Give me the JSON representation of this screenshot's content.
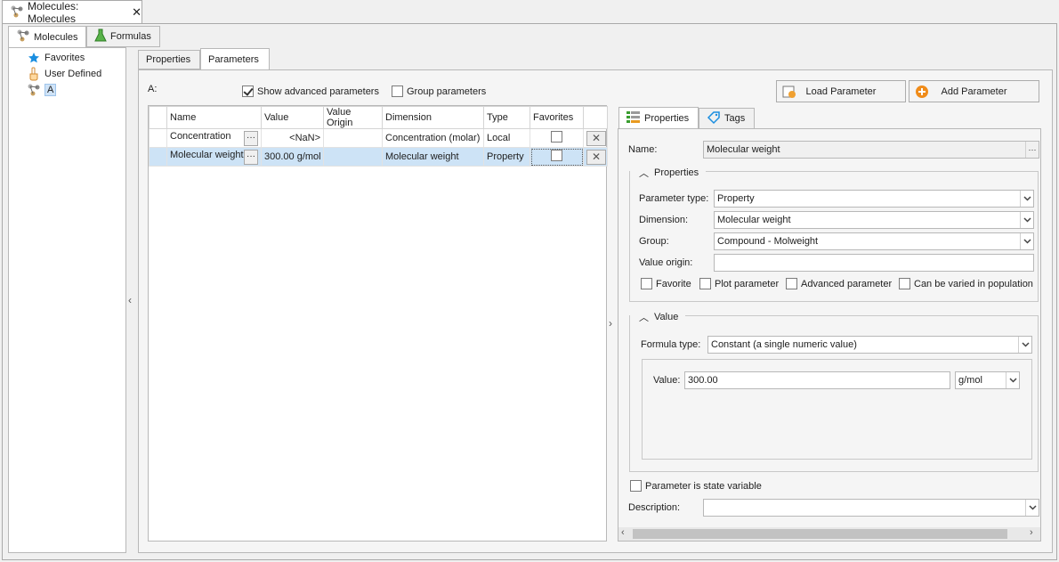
{
  "doc_tab": {
    "title": "Molecules: Molecules",
    "close": "✕"
  },
  "top_tabs": [
    {
      "label": "Molecules"
    },
    {
      "label": "Formulas"
    }
  ],
  "tree": {
    "items": [
      {
        "label": "Favorites"
      },
      {
        "label": "User Defined"
      },
      {
        "label": "A"
      }
    ]
  },
  "sub_tabs": [
    {
      "label": "Properties"
    },
    {
      "label": "Parameters"
    }
  ],
  "params": {
    "container_label": "A:",
    "show_advanced_label": "Show advanced parameters",
    "group_params_label": "Group parameters",
    "load_button": "Load Parameter",
    "add_button": "Add Parameter",
    "columns": [
      "Name",
      "Value",
      "Value Origin",
      "Dimension",
      "Type",
      "Favorites"
    ],
    "rows": [
      {
        "name": "Concentration",
        "value": "<NaN>",
        "origin": "",
        "dimension": "Concentration (molar)",
        "type": "Local"
      },
      {
        "name": "Molecular weight",
        "value": "300.00 g/mol",
        "origin": "",
        "dimension": "Molecular weight",
        "type": "Property"
      }
    ],
    "ellipsis": "···"
  },
  "detail": {
    "tabs": [
      {
        "label": "Properties"
      },
      {
        "label": "Tags"
      }
    ],
    "name_label": "Name:",
    "name_value": "Molecular weight",
    "properties_group": "Properties",
    "param_type_label": "Parameter type:",
    "param_type_value": "Property",
    "dimension_label": "Dimension:",
    "dimension_value": "Molecular weight",
    "group_label": "Group:",
    "group_value": "Compound - Molweight",
    "value_origin_label": "Value origin:",
    "value_origin_value": "",
    "checkboxes": [
      "Favorite",
      "Plot parameter",
      "Advanced parameter",
      "Can be varied in population"
    ],
    "value_group": "Value",
    "formula_type_label": "Formula type:",
    "formula_type_value": "Constant (a single numeric value)",
    "value_label": "Value:",
    "value_value": "300.00",
    "unit_value": "g/mol",
    "state_variable_label": "Parameter is state variable",
    "description_label": "Description:",
    "description_value": ""
  }
}
